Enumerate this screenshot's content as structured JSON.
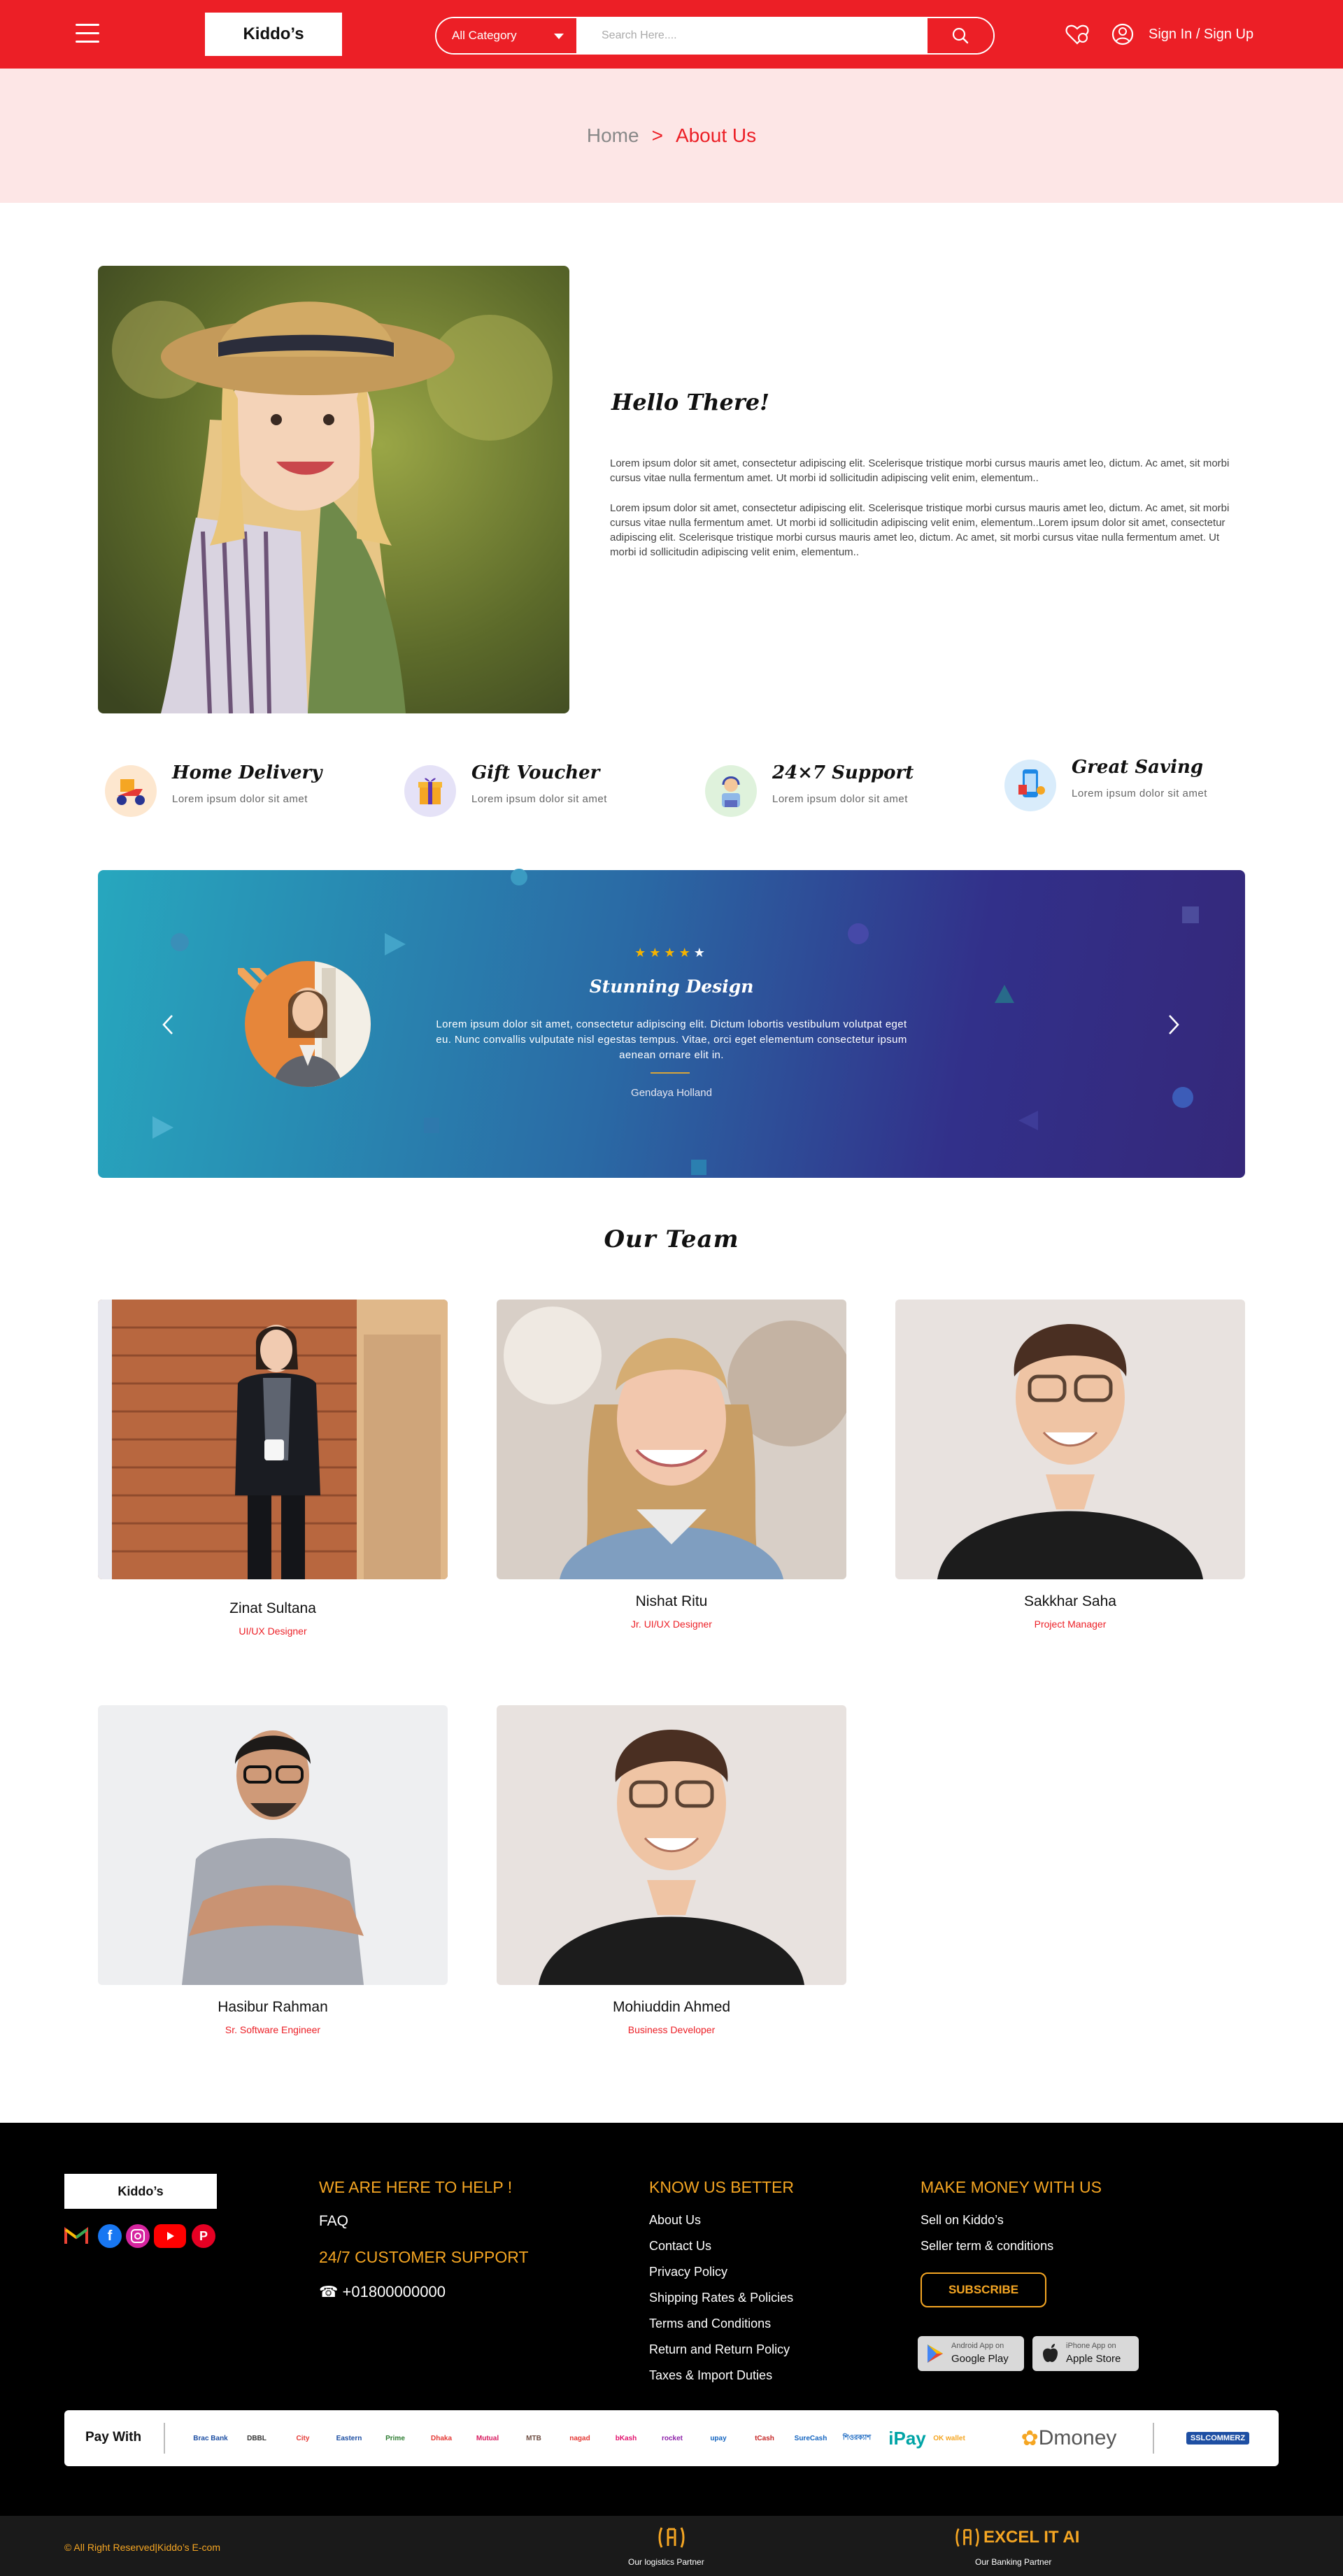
{
  "header": {
    "logo": "Kiddo’s",
    "category": "All Category",
    "search_placeholder": "Search Here....",
    "signin": "Sign In / Sign Up"
  },
  "breadcrumb": {
    "home": "Home",
    "separator": ">",
    "current": "About Us"
  },
  "about": {
    "heading": "Hello There!",
    "para1": "Lorem ipsum dolor sit amet, consectetur adipiscing elit. Scelerisque tristique morbi cursus mauris amet leo, dictum. Ac amet, sit morbi cursus vitae nulla fermentum amet. Ut morbi id sollicitudin adipiscing velit enim, elementum..",
    "para2": "Lorem ipsum dolor sit amet, consectetur adipiscing elit. Scelerisque tristique morbi cursus mauris amet leo, dictum. Ac amet, sit morbi cursus vitae nulla fermentum amet. Ut morbi id sollicitudin adipiscing velit enim, elementum..Lorem ipsum dolor sit amet, consectetur adipiscing elit. Scelerisque tristique morbi cursus mauris amet leo, dictum. Ac amet, sit morbi cursus vitae nulla fermentum amet. Ut morbi id sollicitudin adipiscing velit enim, elementum.."
  },
  "features": [
    {
      "title": "Home Delivery",
      "desc": "Lorem ipsum dolor sit amet",
      "icon": "delivery-scooter-icon"
    },
    {
      "title": "Gift Voucher",
      "desc": "Lorem ipsum dolor sit amet",
      "icon": "gift-box-icon"
    },
    {
      "title": "24×7 Support",
      "desc": "Lorem ipsum dolor sit amet",
      "icon": "support-agent-icon"
    },
    {
      "title": "Great Saving",
      "desc": "Lorem ipsum dolor sit amet",
      "icon": "saving-phone-icon"
    }
  ],
  "testimonial": {
    "stars": "★★★★★",
    "title": "Stunning Design",
    "body": "Lorem ipsum dolor sit amet, consectetur adipiscing elit. Dictum lobortis vestibulum volutpat eget eu. Nunc convallis vulputate nisl egestas tempus. Vitae, orci eget elementum consectetur ipsum aenean ornare elit in.",
    "name": "Gendaya Holland",
    "rating": 4
  },
  "team": {
    "heading": "Our Team",
    "members": [
      {
        "name": "Zinat Sultana",
        "role": "UI/UX Designer"
      },
      {
        "name": "Nishat Ritu",
        "role": "Jr. UI/UX Designer"
      },
      {
        "name": "Sakkhar Saha",
        "role": "Project Manager"
      },
      {
        "name": "Hasibur Rahman",
        "role": "Sr. Software Engineer"
      },
      {
        "name": "Mohiuddin Ahmed",
        "role": "Business Developer"
      }
    ]
  },
  "footer": {
    "logo": "Kiddo’s",
    "help_heading": "WE ARE HERE TO HELP !",
    "faq": "FAQ",
    "support_heading": "24/7 CUSTOMER SUPPORT",
    "phone": "+01800000000",
    "know_heading": "KNOW US BETTER",
    "know_links": [
      "About Us",
      "Contact Us",
      "Privacy Policy",
      "Shipping Rates & Policies",
      "Terms and Conditions",
      "Return and Return Policy",
      "Taxes & Import Duties"
    ],
    "money_heading": "MAKE MONEY WITH US",
    "money_links": [
      "Sell on Kiddo’s",
      "Seller term & conditions"
    ],
    "subscribe": "SUBSCRIBE",
    "google_small": "Android App on",
    "google_big": "Google Play",
    "apple_small": "iPhone App on",
    "apple_big": "Apple Store",
    "pay_with": "Pay With",
    "pay_logos": [
      "Brac Bank",
      "DBBL",
      "City",
      "Eastern",
      "Prime",
      "Dhaka",
      "Mutual",
      "MTB",
      "nagad",
      "bKash",
      "rocket",
      "upay",
      "tCash",
      "SureCash",
      "শিওরক্যাশ",
      "iPay",
      "OK wallet"
    ],
    "dmoney": "Dmoney",
    "sslcommerz": "SSLCOMMERZ",
    "copyright": "© All Right Reserved|Kiddo’s E-com",
    "logistics_label": "Our logistics Partner",
    "excel": "EXCEL IT AI",
    "banking_label": "Our Banking Partner"
  },
  "colors": {
    "brand_red": "#ec1f26",
    "accent_orange": "#f5a623",
    "breadcrumb_bg": "#fde6e6"
  }
}
